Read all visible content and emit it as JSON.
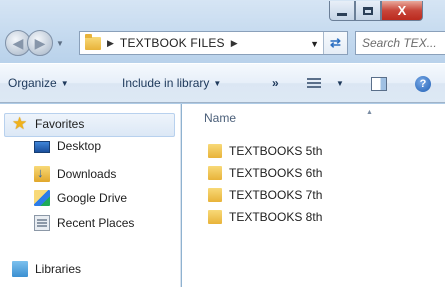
{
  "window_controls": {
    "close_label": "X"
  },
  "address_bar": {
    "breadcrumb": "TEXTBOOK FILES"
  },
  "search": {
    "placeholder": "Search TEX..."
  },
  "toolbar": {
    "organize_label": "Organize",
    "include_label": "Include in library",
    "more_label": "»",
    "help_label": "?"
  },
  "nav_pane": {
    "favorites_label": "Favorites",
    "items": [
      {
        "label": "Desktop",
        "icon": "desktop-icon"
      },
      {
        "label": "Downloads",
        "icon": "downloads-icon"
      },
      {
        "label": "Google Drive",
        "icon": "google-drive-icon"
      },
      {
        "label": "Recent Places",
        "icon": "recent-places-icon"
      }
    ],
    "libraries_label": "Libraries"
  },
  "file_list": {
    "column_header": "Name",
    "items": [
      {
        "name": "TEXTBOOKS  5th"
      },
      {
        "name": "TEXTBOOKS  6th"
      },
      {
        "name": "TEXTBOOKS  7th"
      },
      {
        "name": "TEXTBOOKS 8th"
      }
    ]
  },
  "colors": {
    "chrome": "#b5cfe9",
    "favorites_highlight": "#dce8f6",
    "close_button": "#c8463a",
    "folder": "#e8b33a"
  }
}
